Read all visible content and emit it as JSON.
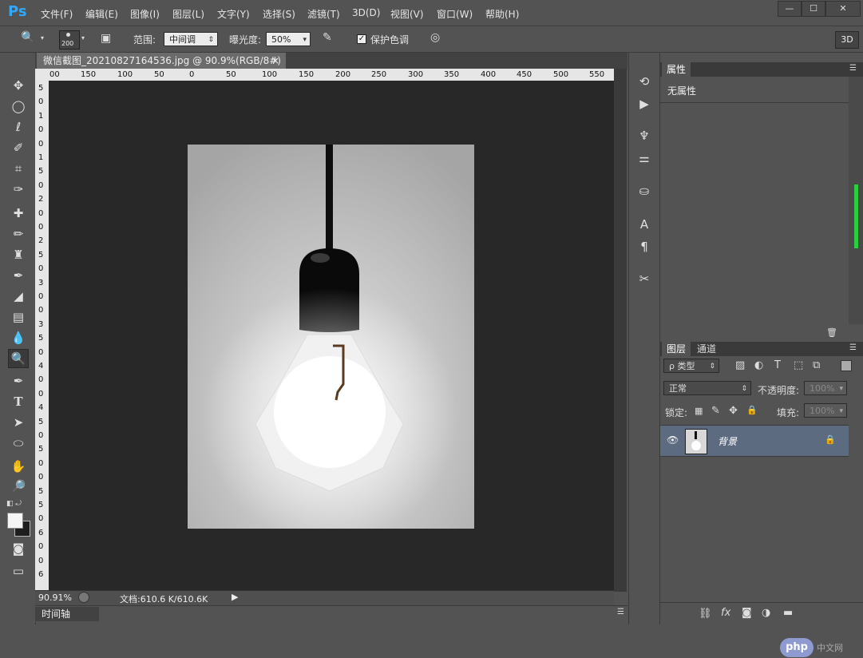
{
  "app": {
    "logo": "Ps",
    "menu": [
      "文件(F)",
      "编辑(E)",
      "图像(I)",
      "图层(L)",
      "文字(Y)",
      "选择(S)",
      "滤镜(T)",
      "3D(D)",
      "视图(V)",
      "窗口(W)",
      "帮助(H)"
    ],
    "window_buttons": [
      "—",
      "☐",
      "✕"
    ]
  },
  "options": {
    "brush_size": "200",
    "range_label": "范围:",
    "range_value": "中间调",
    "exposure_label": "曝光度:",
    "exposure_value": "50%",
    "protect_tones_label": "保护色调",
    "protect_tones_checked": true,
    "btn_3d": "3D"
  },
  "document": {
    "tab_title": "微信截图_20210827164536.jpg @ 90.9%(RGB/8#) *",
    "ruler_h": [
      "00",
      "150",
      "100",
      "50",
      "0",
      "50",
      "100",
      "150",
      "200",
      "250",
      "300",
      "350",
      "400",
      "450",
      "500",
      "550"
    ],
    "ruler_v": [
      "5",
      "0",
      "1",
      "0",
      "0",
      "1",
      "5",
      "0",
      "2",
      "0",
      "0",
      "2",
      "5",
      "0",
      "3",
      "0",
      "0",
      "3",
      "5",
      "0",
      "4",
      "0",
      "0",
      "4",
      "5",
      "0",
      "5",
      "0",
      "0",
      "5",
      "5",
      "0",
      "6",
      "0",
      "0",
      "6"
    ]
  },
  "status": {
    "zoom": "90.91%",
    "doc_info": "文档:610.6 K/610.6K"
  },
  "timeline_label": "时间轴",
  "properties": {
    "tab": "属性",
    "content": "无属性"
  },
  "layers": {
    "tabs": [
      "图层",
      "通道"
    ],
    "filter_label": "ρ 类型",
    "blend_mode": "正常",
    "opacity_label": "不透明度:",
    "opacity_value": "100%",
    "lock_label": "锁定:",
    "fill_label": "填充:",
    "fill_value": "100%",
    "layer_name": "背景"
  },
  "watermark": "php 中文网",
  "colors": {
    "accent": "#31a8ff",
    "selected_layer": "#5c6b80",
    "canvas_bg": "#282828"
  }
}
